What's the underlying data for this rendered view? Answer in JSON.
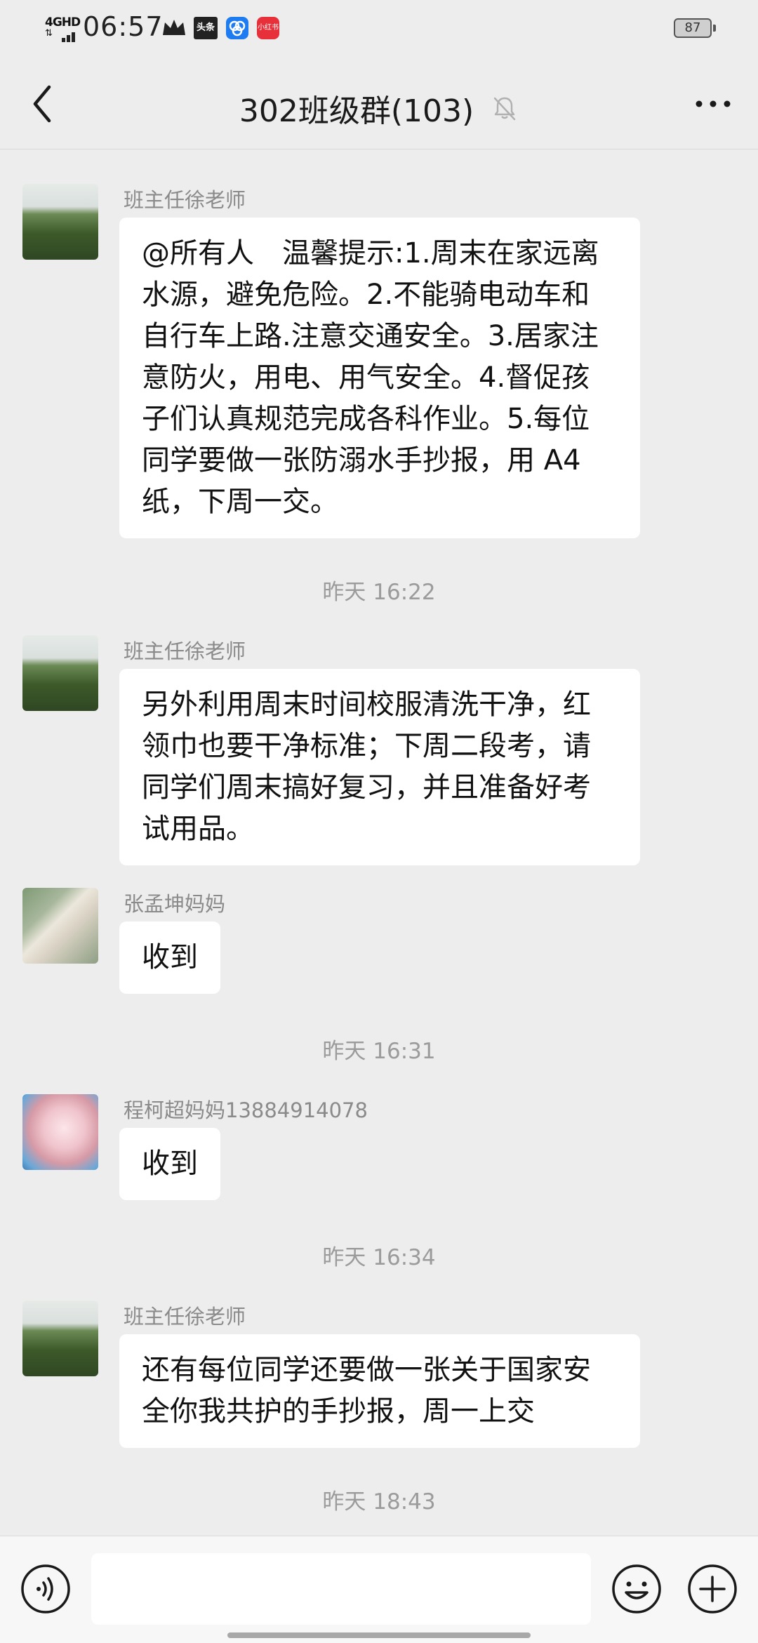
{
  "status_bar": {
    "network": "4GHD",
    "time": "06:57",
    "toutiao_label": "头条",
    "red_app_label": "小红书",
    "battery": "87"
  },
  "header": {
    "title": "302班级群(103)"
  },
  "messages": [
    {
      "sender": "班主任徐老师",
      "text": "@所有人　温馨提示:1.周末在家远离水源，避免危险。2.不能骑电动车和自行车上路.注意交通安全。3.居家注意防火，用电、用气安全。4.督促孩子们认真规范完成各科作业。5.每位同学要做一张防溺水手抄报，用 A4 纸，下周一交。"
    },
    {
      "timestamp": "昨天 16:22"
    },
    {
      "sender": "班主任徐老师",
      "text": "另外利用周末时间校服清洗干净，红领巾也要干净标准；下周二段考，请同学们周末搞好复习，并且准备好考试用品。"
    },
    {
      "sender": "张孟坤妈妈",
      "text": "收到"
    },
    {
      "timestamp": "昨天 16:31"
    },
    {
      "sender": "程柯超妈妈13884914078",
      "text": "收到"
    },
    {
      "timestamp": "昨天 16:34"
    },
    {
      "sender": "班主任徐老师",
      "text": "还有每位同学还要做一张关于国家安全你我共护的手抄报，周一上交"
    },
    {
      "timestamp": "昨天 18:43"
    }
  ],
  "input": {
    "value": "",
    "placeholder": ""
  },
  "icons": {
    "back": "back-arrow-icon",
    "mute": "bell-off-icon",
    "more": "more-dots-icon",
    "voice": "voice-icon",
    "emoji": "emoji-icon",
    "plus": "plus-icon"
  },
  "colors": {
    "background": "#ededed",
    "bubble": "#ffffff",
    "meta_text": "#9b9b9b"
  }
}
